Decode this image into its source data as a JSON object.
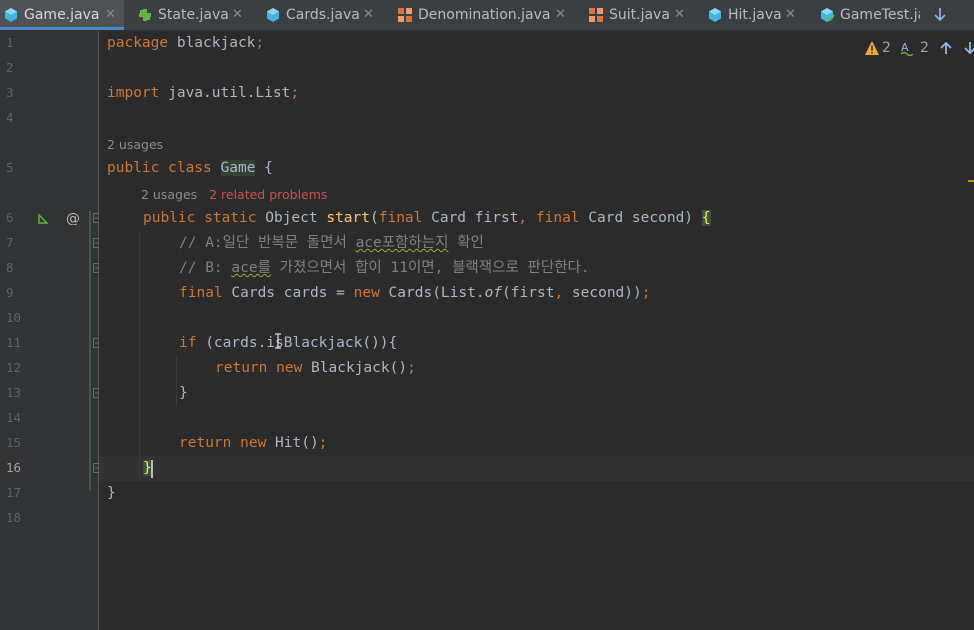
{
  "tabs": [
    {
      "label": "Game.java",
      "icon": "java-class-icon",
      "active": true
    },
    {
      "label": "State.java",
      "icon": "java-interface-icon"
    },
    {
      "label": "Cards.java",
      "icon": "java-class-icon"
    },
    {
      "label": "Denomination.java",
      "icon": "java-enum-icon"
    },
    {
      "label": "Suit.java",
      "icon": "java-enum-icon"
    },
    {
      "label": "Hit.java",
      "icon": "java-class-icon"
    },
    {
      "label": "GameTest.ja",
      "icon": "java-test-class-icon"
    }
  ],
  "close_glyph": "✕",
  "inspections": {
    "warnings": "2",
    "typos": "2"
  },
  "hints": {
    "class_usages": "2 usages",
    "method_usages": "2 usages",
    "method_problems": "2 related problems"
  },
  "lines": {
    "l1": {
      "num": "1",
      "kw": "package",
      "rest": " blackjack",
      "semi": ";"
    },
    "l2": {
      "num": "2"
    },
    "l3": {
      "num": "3",
      "kw": "import",
      "rest": " java.util.List",
      "semi": ";"
    },
    "l4": {
      "num": "4"
    },
    "l5": {
      "num": "5",
      "kw1": "public",
      "kw2": " class ",
      "name": "Game",
      "rest": " {"
    },
    "l6": {
      "num": "6",
      "kw1": "public",
      "kw2": " static ",
      "type": "Object ",
      "fn": "start",
      "p1": "(",
      "kw3": "final",
      "p2": " Card first",
      "comma": ",",
      "kw4": " final",
      "p3": " Card second)",
      "brace": "{"
    },
    "l7": {
      "num": "7",
      "a": "// A:일단 반복문 돌면서 ",
      "w": "ace포함하는지",
      "b": " 확인"
    },
    "l8": {
      "num": "8",
      "a": "// B: ",
      "w": "ace를",
      "b": " 가졌으면서 합이 11이면, 블랙잭으로 판단한다."
    },
    "l9": {
      "num": "9",
      "kw": "final",
      "a": " Cards cards = ",
      "kw2": "new",
      "b": " Cards(List.",
      "it": "of",
      "c": "(first",
      "comma": ",",
      "d": " second))",
      "semi": ";"
    },
    "l10": {
      "num": "10"
    },
    "l11": {
      "num": "11",
      "kw": "if",
      "a": " (cards.isBlackjack()){"
    },
    "l12": {
      "num": "12",
      "kw": "return",
      "kw2": " new",
      "a": " Blackjack()",
      "semi": ";"
    },
    "l13": {
      "num": "13",
      "a": "}"
    },
    "l14": {
      "num": "14"
    },
    "l15": {
      "num": "15",
      "kw": "return",
      "kw2": " new",
      "a": " Hit()",
      "semi": ";"
    },
    "l16": {
      "num": "16",
      "a": "}"
    },
    "l17": {
      "num": "17",
      "a": "}"
    },
    "l18": {
      "num": "18"
    }
  },
  "colors": {
    "keyword": "#cc7832",
    "comment": "#808080",
    "function": "#ffc66d",
    "text": "#a9b7c6",
    "accent": "#4a88c7"
  }
}
